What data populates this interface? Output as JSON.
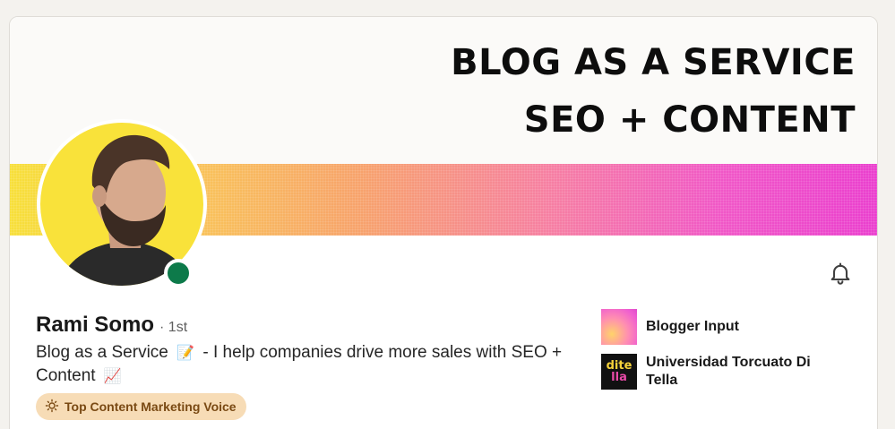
{
  "cover": {
    "line1": "BLOG AS A SERVICE",
    "line2": "SEO + CONTENT",
    "gradient_colors": [
      "#f7df3a",
      "#f9c25a",
      "#f7a36b",
      "#f67fa2",
      "#f057c7",
      "#ea3fce"
    ]
  },
  "profile": {
    "name": "Rami Somo",
    "degree": "· 1st",
    "headline_part1": "Blog as a Service",
    "headline_emoji1": "📝",
    "headline_part2": "- I help companies drive more sales with SEO + Content",
    "headline_emoji2": "📈",
    "status": "online",
    "status_color": "#0d7a4a"
  },
  "badge": {
    "label": "Top Content Marketing Voice",
    "icon": "lightbulb-icon"
  },
  "organizations": [
    {
      "name": "Blogger Input",
      "logo": "gradient-logo"
    },
    {
      "name": "Universidad Torcuato Di Tella",
      "logo_text_top": "dite",
      "logo_text_bottom": "lla"
    }
  ],
  "actions": {
    "notify_icon": "bell-icon"
  }
}
